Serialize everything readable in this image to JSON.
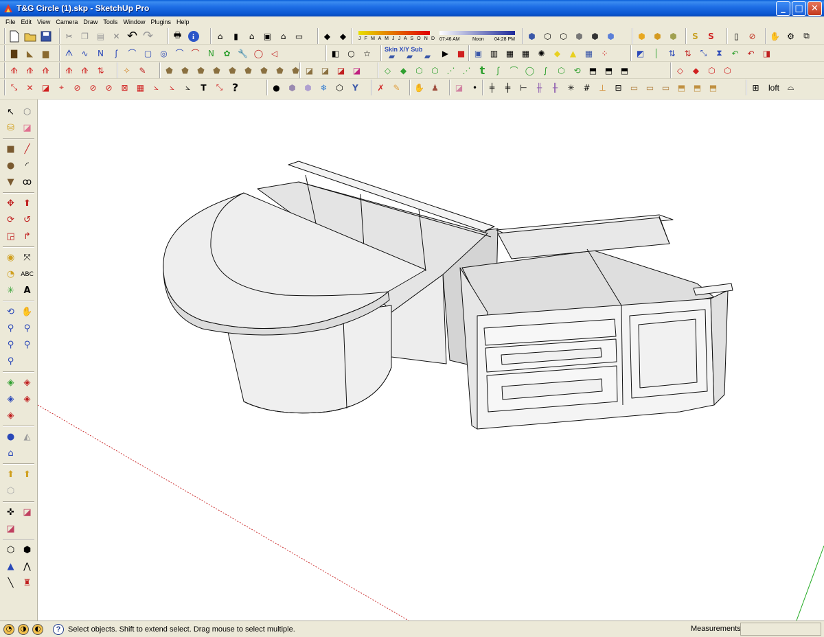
{
  "window": {
    "title": "T&G Circle (1).skp - SketchUp Pro",
    "minimize_glyph": "_",
    "maximize_glyph": "□",
    "close_glyph": "✕"
  },
  "menu": [
    "File",
    "Edit",
    "View",
    "Camera",
    "Draw",
    "Tools",
    "Window",
    "Plugins",
    "Help"
  ],
  "shadow_toolbar": {
    "months": "J F M A M J J A S O N D",
    "time_start": "07:46 AM",
    "time_mid": "Noon",
    "time_end": "04:28 PM"
  },
  "skin_label": "Skin X/Y Sub",
  "loft_label": "loft",
  "status": {
    "message": "Select objects. Shift to extend select. Drag mouse to select multiple.",
    "measurements_label": "Measurements",
    "measurements_value": "",
    "help_glyph": "?"
  },
  "colors": {
    "titlebar": "#1F6FE6",
    "chrome": "#ECE9D8",
    "canvas": "#FFFFFF",
    "model_face": "#E6E6E6",
    "axis_red": "#CC3333",
    "axis_green": "#22AA22"
  },
  "icons": {
    "row1": [
      "new-icon",
      "open-icon",
      "save-icon",
      "cut-icon",
      "copy-icon",
      "paste-icon",
      "erase-icon",
      "undo-icon",
      "redo-icon",
      "print-icon",
      "model-info-icon",
      "iso-view-icon",
      "top-view-icon",
      "front-view-icon",
      "right-view-icon",
      "back-view-icon",
      "left-view-icon",
      "shadow-settings-icon",
      "display-shadows-icon",
      "x-ray-icon",
      "wireframe-icon",
      "hidden-line-icon",
      "shaded-icon",
      "shaded-textures-icon",
      "monochrome-icon",
      "section-plane-icon",
      "section-cut-icon",
      "section-display-icon",
      "sandbox-icon",
      "erase-tool-icon",
      "hand-icon",
      "components-icon",
      "layers-icon"
    ],
    "left": [
      "select-icon",
      "make-component-icon",
      "paint-bucket-icon",
      "eraser-icon",
      "rectangle-icon",
      "line-icon",
      "circle-icon",
      "arc-icon",
      "polygon-icon",
      "freehand-icon",
      "move-icon",
      "push-pull-icon",
      "rotate-icon",
      "follow-me-icon",
      "scale-icon",
      "offset-icon",
      "tape-measure-icon",
      "dimension-icon",
      "protractor-icon",
      "text-icon",
      "axes-icon",
      "3d-text-icon",
      "orbit-icon",
      "pan-icon",
      "zoom-icon",
      "zoom-window-icon",
      "zoom-extents-icon",
      "previous-view-icon",
      "walk-icon",
      "look-around-icon",
      "position-camera-icon",
      "add-location-icon",
      "toggle-terrain-icon",
      "get-models-icon",
      "share-model-icon",
      "share-component-icon",
      "photo-texture-icon",
      "geo-icon",
      "iso-box-icon",
      "section-box-icon",
      "perspective-icon",
      "two-point-icon",
      "knife-icon",
      "joystick-icon"
    ]
  }
}
